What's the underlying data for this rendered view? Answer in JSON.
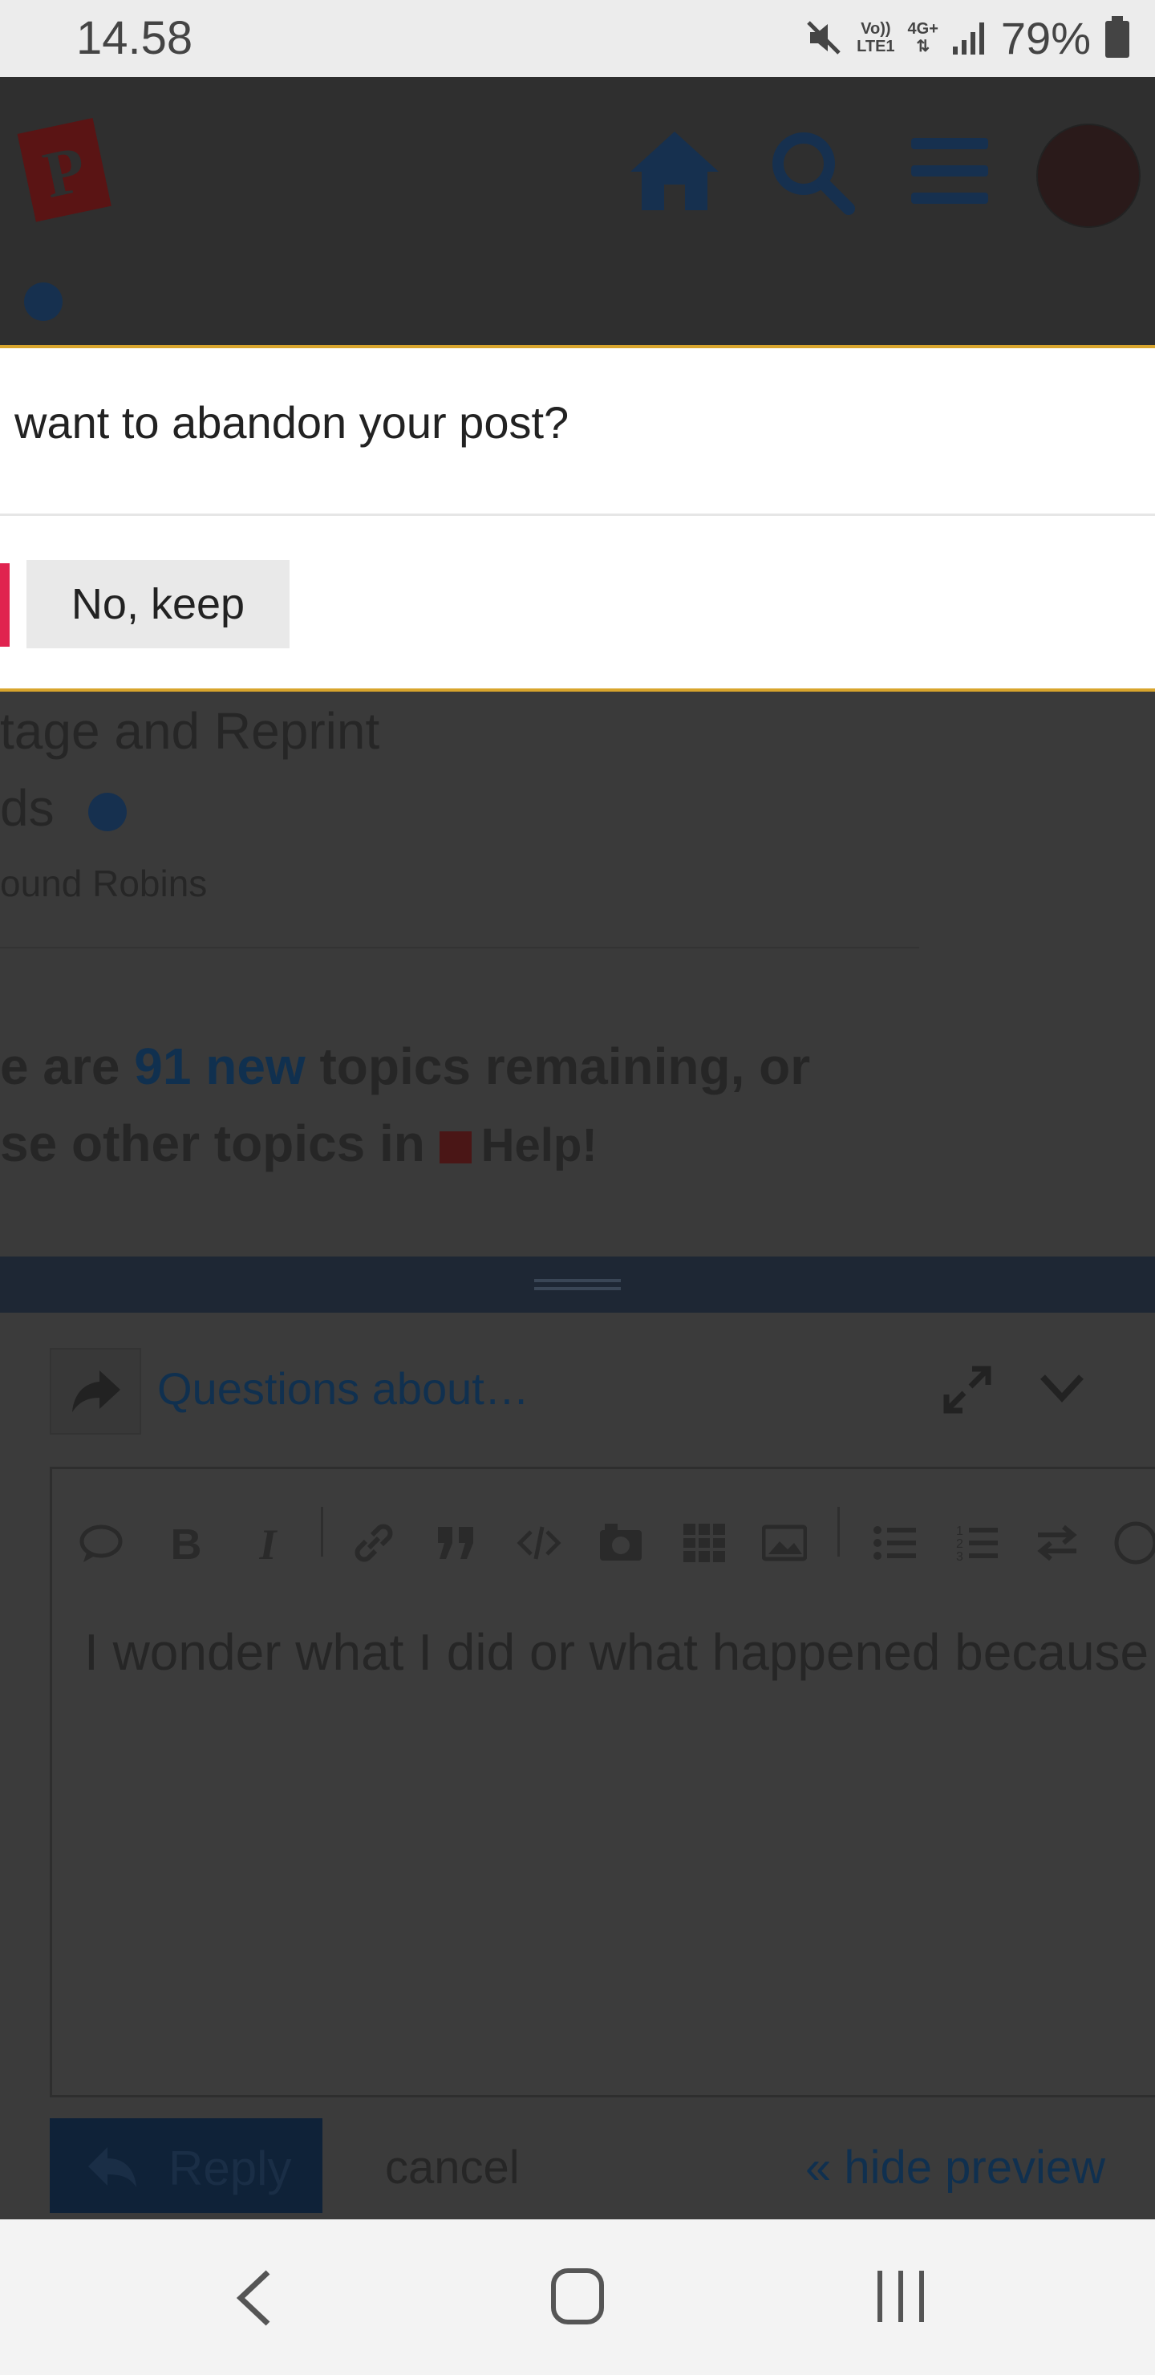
{
  "status_bar": {
    "time": "14.58",
    "network_top": "Vo))",
    "network_bottom": "LTE1",
    "data_type": "4G+",
    "battery": "79%"
  },
  "modal": {
    "message": "want to abandon your post?",
    "keep_label": "No, keep"
  },
  "topic": {
    "title_line1": "tage and Reprint",
    "title_line2": "ds",
    "category": "ound Robins"
  },
  "suggested": {
    "line1_pre": "e are ",
    "line1_link": "91 new",
    "line1_post": " topics remaining, or",
    "line2_pre": "se other topics in ",
    "line2_category": "Help!"
  },
  "composer": {
    "reply_title": "Questions about…",
    "body_text": "I wonder what I did or what happened because",
    "reply_button": "Reply",
    "cancel_link": "cancel",
    "hide_preview": "« hide preview"
  },
  "colors": {
    "modal_border": "#d8a52d",
    "danger": "#e0234f",
    "link_blue": "#10304f"
  }
}
